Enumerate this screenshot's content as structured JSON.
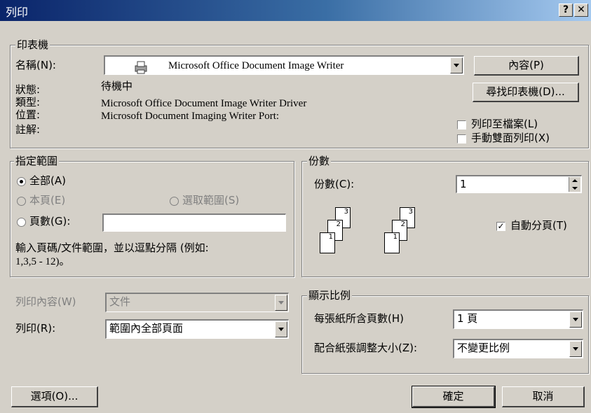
{
  "window": {
    "title": "列印",
    "help_label": "?",
    "close_label": "✕"
  },
  "printer": {
    "group_label": "印表機",
    "name_label": "名稱(N):",
    "name_value": "Microsoft Office Document Image Writer",
    "properties_label": "內容(P)",
    "find_printer_label": "尋找印表機(D)...",
    "status_label": "狀態:",
    "status_value": "待機中",
    "type_label": "類型:",
    "type_value": "Microsoft Office Document Image Writer Driver",
    "where_label": "位置:",
    "where_value": "Microsoft Document Imaging Writer Port:",
    "comment_label": "註解:",
    "print_to_file_label": "列印至檔案(L)",
    "manual_duplex_label": "手動雙面列印(X)"
  },
  "page_range": {
    "group_label": "指定範圍",
    "all_label": "全部(A)",
    "current_label": "本頁(E)",
    "selection_label": "選取範圍(S)",
    "pages_label": "頁數(G):",
    "pages_value": "",
    "hint": "輸入頁碼/文件範圍，並以逗點分隔 (例如:",
    "hint2": "1,3,5 - 12)。"
  },
  "copies": {
    "group_label": "份數",
    "count_label": "份數(C):",
    "count_value": "1",
    "collate_label": "自動分頁(T)",
    "collate_checked": true,
    "page_numbers": [
      "1",
      "2",
      "3"
    ]
  },
  "print_what": {
    "label": "列印內容(W)",
    "value": "文件"
  },
  "print": {
    "label": "列印(R):",
    "value": "範圍內全部頁面"
  },
  "zoom": {
    "group_label": "顯示比例",
    "pages_per_sheet_label": "每張紙所含頁數(H)",
    "pages_per_sheet_value": "1 頁",
    "scale_label": "配合紙張調整大小(Z):",
    "scale_value": "不變更比例"
  },
  "buttons": {
    "options_label": "選項(O)...",
    "ok_label": "確定",
    "cancel_label": "取消"
  }
}
